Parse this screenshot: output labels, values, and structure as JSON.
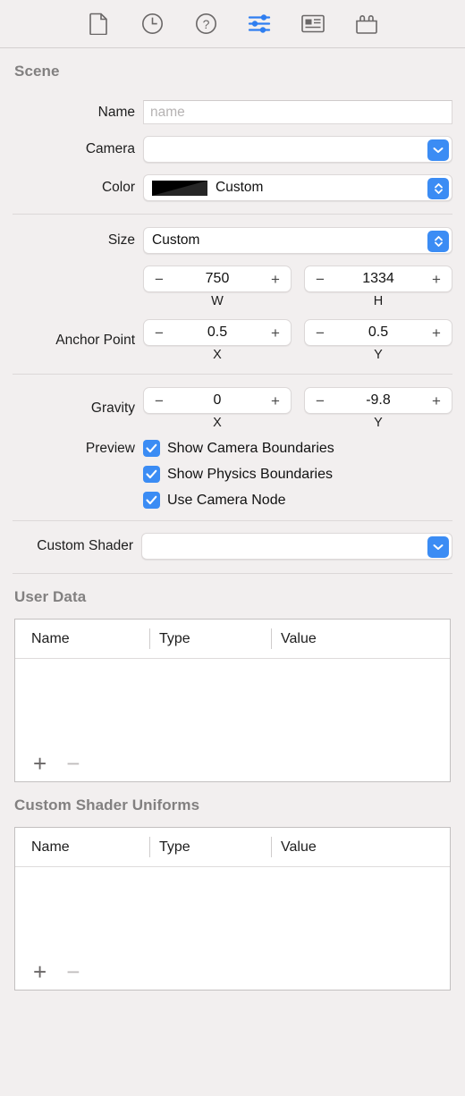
{
  "toolbar": {
    "items": [
      {
        "name": "file-inspector-icon",
        "label": "File Inspector",
        "active": false
      },
      {
        "name": "history-inspector-icon",
        "label": "History Inspector",
        "active": false
      },
      {
        "name": "quick-help-inspector-icon",
        "label": "Quick Help Inspector",
        "active": false
      },
      {
        "name": "attributes-inspector-icon",
        "label": "Attributes Inspector",
        "active": true
      },
      {
        "name": "media-library-icon",
        "label": "Media Library",
        "active": false
      },
      {
        "name": "object-library-icon",
        "label": "Object Library",
        "active": false
      }
    ]
  },
  "scene": {
    "title": "Scene",
    "name": {
      "label": "Name",
      "value": "",
      "placeholder": "name"
    },
    "camera": {
      "label": "Camera",
      "value": ""
    },
    "color": {
      "label": "Color",
      "value": "Custom",
      "swatch": "#000000"
    },
    "size": {
      "label": "Size",
      "value": "Custom"
    },
    "size_fields": [
      {
        "value": "750",
        "axis": "W",
        "minus": "−",
        "plus": "+"
      },
      {
        "value": "1334",
        "axis": "H",
        "minus": "−",
        "plus": "+"
      }
    ],
    "anchor_point": {
      "label": "Anchor Point",
      "fields": [
        {
          "value": "0.5",
          "axis": "X",
          "minus": "−",
          "plus": "+"
        },
        {
          "value": "0.5",
          "axis": "Y",
          "minus": "−",
          "plus": "+"
        }
      ]
    },
    "gravity": {
      "label": "Gravity",
      "fields": [
        {
          "value": "0",
          "axis": "X",
          "minus": "−",
          "plus": "+"
        },
        {
          "value": "-9.8",
          "axis": "Y",
          "minus": "−",
          "plus": "+"
        }
      ]
    },
    "preview": {
      "label": "Preview",
      "options": [
        {
          "label": "Show Camera Boundaries",
          "checked": true
        },
        {
          "label": "Show Physics Boundaries",
          "checked": true
        },
        {
          "label": "Use Camera Node",
          "checked": true
        }
      ]
    },
    "custom_shader": {
      "label": "Custom Shader",
      "value": ""
    }
  },
  "user_data": {
    "title": "User Data",
    "columns": [
      "Name",
      "Type",
      "Value"
    ],
    "rows": [],
    "add_label": "+",
    "remove_label": "−"
  },
  "custom_shader_uniforms": {
    "title": "Custom Shader Uniforms",
    "columns": [
      "Name",
      "Type",
      "Value"
    ],
    "rows": [],
    "add_label": "+",
    "remove_label": "−"
  },
  "colors": {
    "accent": "#3b8cf4",
    "background": "#f2efef",
    "field": "#ffffff",
    "section_title": "#828080"
  }
}
